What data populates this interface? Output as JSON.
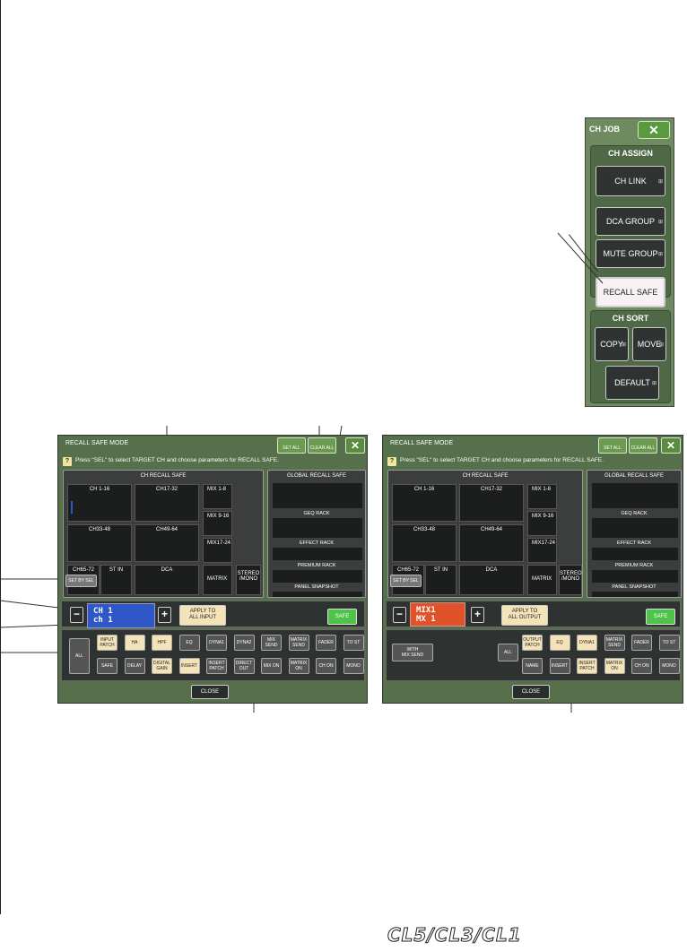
{
  "ch_job": {
    "title": "CH JOB",
    "close": "✕",
    "assign_title": "CH ASSIGN",
    "ch_link": "CH LINK",
    "dca_group": "DCA GROUP",
    "mute_group": "MUTE GROUP",
    "recall_safe": "RECALL SAFE",
    "sort_title": "CH SORT",
    "copy": "COPY",
    "move": "MOVE",
    "default": "DEFAULT"
  },
  "panel_left": {
    "title": "RECALL SAFE MODE",
    "set_all": "SET ALL",
    "clear_all": "CLEAR ALL",
    "close_x": "✕",
    "hint": "Press \"SEL\" to select TARGET CH and choose parameters for RECALL SAFE.",
    "ch_recall_safe": "CH RECALL SAFE",
    "groups": {
      "ch1_16": "CH 1-16",
      "ch17_32": "CH17-32",
      "mix1_8": "MIX 1-8",
      "ch33_48": "CH33-48",
      "ch49_64": "CH49-64",
      "mix9_16": "MIX 9-16",
      "ch65_72": "CH65-72",
      "stin": "ST IN",
      "dca": "DCA",
      "mix17_24": "MIX17-24",
      "matrix": "MATRIX",
      "stereo": "STEREO\n/MONO"
    },
    "set_by_sel": "SET BY SEL",
    "ch_line1": "CH 1",
    "ch_line2": "ch 1",
    "minus": "−",
    "plus": "+",
    "apply": "APPLY TO\nALL INPUT",
    "safe": "SAFE",
    "all": "ALL",
    "buttons_row1": [
      "INPUT PATCH",
      "HA",
      "HPF",
      "EQ",
      "DYNA1",
      "DYNA2",
      "MIX SEND",
      "MATRIX SEND",
      "FADER",
      "TO ST"
    ],
    "buttons_row2": [
      "SAFE",
      "DELAY",
      "DIGITAL GAIN",
      "INSERT",
      "INSERT PATCH",
      "DIRECT OUT",
      "MIX ON",
      "MATRIX ON",
      "CH ON",
      "MONO"
    ],
    "close": "CLOSE"
  },
  "global": {
    "title": "GLOBAL RECALL SAFE",
    "geq": "GEQ RACK",
    "effect": "EFFECT RACK",
    "premium": "PREMIUM RACK",
    "snapshot": "PANEL SNAPSHOT"
  },
  "panel_right": {
    "title": "RECALL SAFE MODE",
    "set_all": "SET ALL",
    "clear_all": "CLEAR ALL",
    "close_x": "✕",
    "hint": "Press \"SEL\" to select TARGET CH and choose parameters for RECALL SAFE.",
    "ch_recall_safe": "CH RECALL SAFE",
    "set_by_sel": "SET BY SEL",
    "mx_line1": "MIX1",
    "mx_line2": "MX 1",
    "minus": "−",
    "plus": "+",
    "apply": "APPLY TO\nALL OUTPUT",
    "safe": "SAFE",
    "with_mix_send": "WITH\nMIX SEND",
    "all": "ALL",
    "buttons_row1": [
      "OUTPUT PATCH",
      "EQ",
      "DYNA1",
      "MATRIX SEND",
      "FADER",
      "TO ST"
    ],
    "buttons_row2": [
      "NAME",
      "INSERT",
      "INSERT PATCH",
      "MATRIX ON",
      "CH ON",
      "MONO"
    ],
    "close": "CLOSE"
  },
  "footer": "CL5/CL3/CL1"
}
